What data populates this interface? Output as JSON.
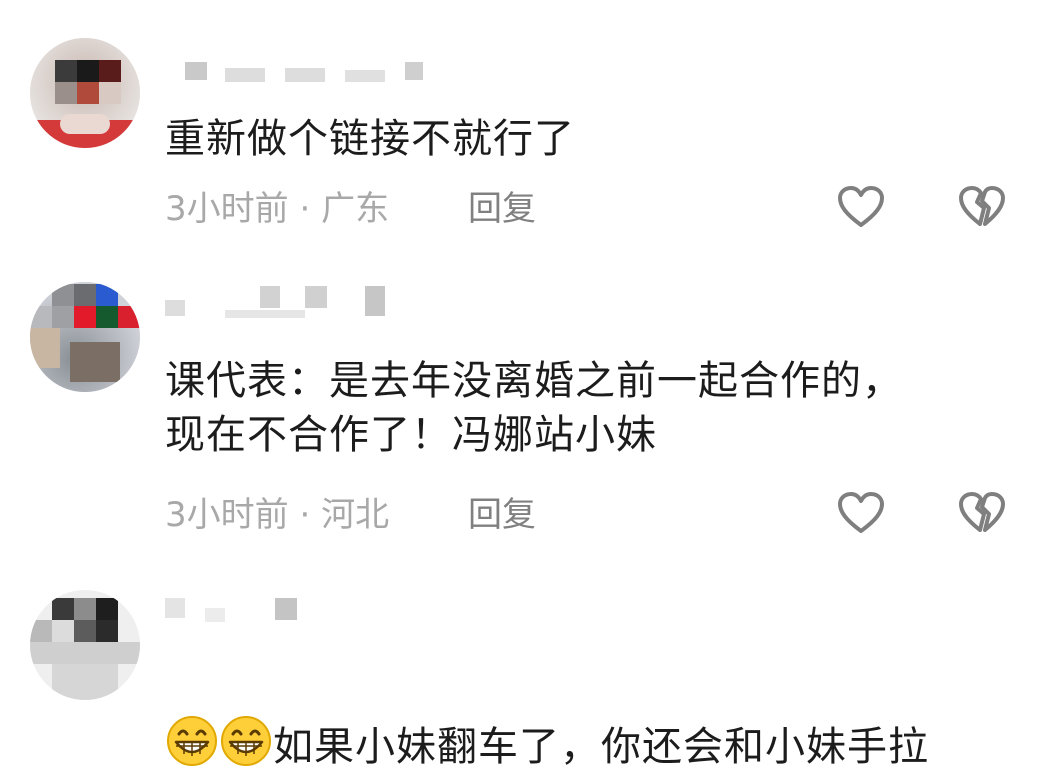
{
  "comments": [
    {
      "text": "重新做个链接不就行了",
      "time": "3小时前",
      "separator": "·",
      "location": "广东",
      "reply_label": "回复"
    },
    {
      "text": "课代表：是去年没离婚之前一起合作的，\n现在不合作了！冯娜站小妹",
      "time": "3小时前",
      "separator": "·",
      "location": "河北",
      "reply_label": "回复"
    },
    {
      "text": "如果小妹翻车了，你还会和小妹手拉",
      "emoji": "grinning-face-emoji"
    }
  ],
  "colors": {
    "text": "#1c1c1c",
    "meta": "#a8a8a8",
    "icon": "#7f7f7f"
  },
  "icons": [
    "heart-outline-icon",
    "broken-heart-icon"
  ]
}
